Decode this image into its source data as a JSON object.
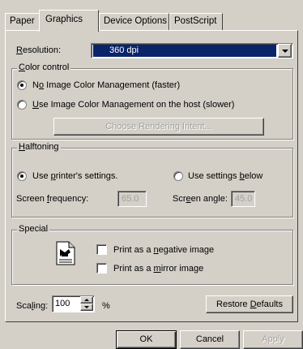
{
  "tabs": [
    {
      "label": "Paper"
    },
    {
      "label": "Graphics"
    },
    {
      "label": "Device Options"
    },
    {
      "label": "PostScript"
    }
  ],
  "resolution": {
    "label_pre": "R",
    "label_post": "esolution:",
    "value": "360 dpi"
  },
  "color_control": {
    "title_pre": "C",
    "title_post": "olor control",
    "option1_pre": "N",
    "option1_u": "o",
    "option1_post": " Image Color Management (faster)",
    "option2_pre": "U",
    "option2_post": "se Image Color Management on the host (slower)",
    "rendering_button": "Choose Rendering Intent..."
  },
  "halftoning": {
    "title_pre": "H",
    "title_post": "alftoning",
    "use_printer_pre": "Use ",
    "use_printer_u": "p",
    "use_printer_post": "rinter's settings.",
    "use_below_pre": "Use settings ",
    "use_below_u": "b",
    "use_below_post": "elow",
    "freq_pre": "Screen ",
    "freq_u": "f",
    "freq_post": "requency:",
    "freq_value": "65.0",
    "angle_pre": "Scr",
    "angle_u": "e",
    "angle_post": "en angle:",
    "angle_value": "45.0"
  },
  "special": {
    "title": "Special",
    "negative_pre": "Print as a ",
    "negative_u": "n",
    "negative_post": "egative image",
    "mirror_pre": "Print as a ",
    "mirror_u": "m",
    "mirror_post": "irror image"
  },
  "scaling": {
    "label_pre": "Sca",
    "label_u": "l",
    "label_post": "ing:",
    "value": "100",
    "unit": "%"
  },
  "restore": {
    "pre": "Restore ",
    "u": "D",
    "post": "efaults"
  },
  "footer": {
    "ok": "OK",
    "cancel": "Cancel",
    "apply": "Apply"
  }
}
